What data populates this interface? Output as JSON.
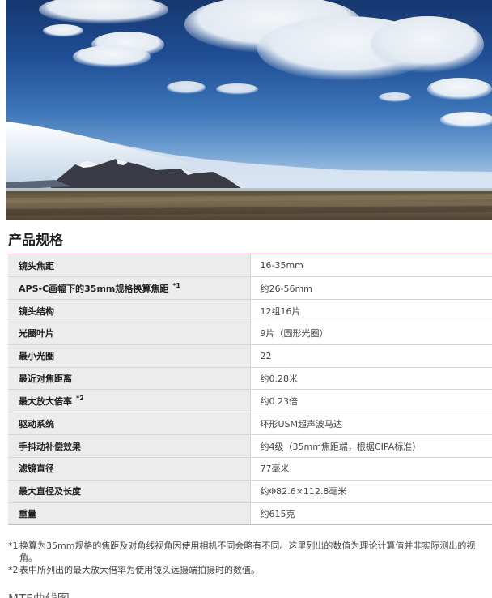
{
  "hero": {
    "image_description_icon": "landscape-photo"
  },
  "section": {
    "title": "产品规格"
  },
  "specs": [
    {
      "label": "镜头焦距",
      "note": "",
      "value": "16-35mm"
    },
    {
      "label": "APS-C画幅下的35mm规格换算焦距",
      "note": "*1",
      "value": "约26-56mm"
    },
    {
      "label": "镜头结构",
      "note": "",
      "value": "12组16片"
    },
    {
      "label": "光圈叶片",
      "note": "",
      "value": "9片（圆形光圈）"
    },
    {
      "label": "最小光圈",
      "note": "",
      "value": "22"
    },
    {
      "label": "最近对焦距离",
      "note": "",
      "value": "约0.28米"
    },
    {
      "label": "最大放大倍率",
      "note": "*2",
      "value": "约0.23倍"
    },
    {
      "label": "驱动系统",
      "note": "",
      "value": "环形USM超声波马达"
    },
    {
      "label": "手抖动补偿效果",
      "note": "",
      "value": "约4级（35mm焦距端，根据CIPA标准）"
    },
    {
      "label": "滤镜直径",
      "note": "",
      "value": "77毫米"
    },
    {
      "label": "最大直径及长度",
      "note": "",
      "value": "约Φ82.6×112.8毫米"
    },
    {
      "label": "重量",
      "note": "",
      "value": "约615克"
    }
  ],
  "footnotes": [
    {
      "mark": "*1",
      "text": "换算为35mm规格的焦距及对角线视角因使用相机不同会略有不同。这里列出的数值为理论计算值并非实际测出的视角。"
    },
    {
      "mark": "*2",
      "text": "表中所列出的最大放大倍率为使用镜头远摄端拍摄时的数值。"
    }
  ],
  "next_section": {
    "title": "MTF曲线图"
  }
}
